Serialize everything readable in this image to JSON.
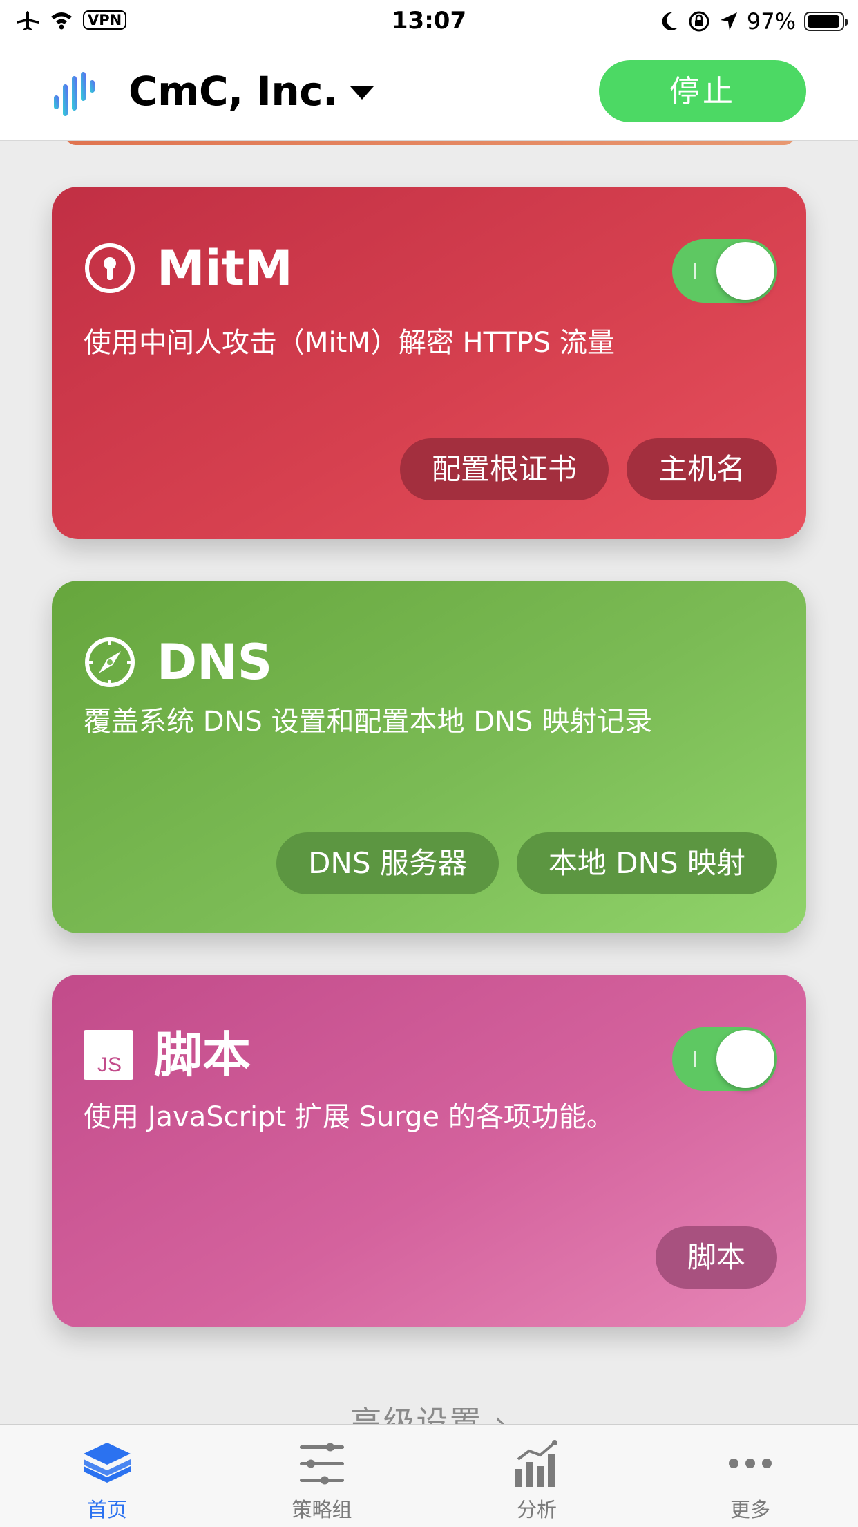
{
  "status_bar": {
    "vpn_label": "VPN",
    "time": "13:07",
    "battery": "97%"
  },
  "nav": {
    "profile_name": "CmC, Inc.",
    "stop_label": "停止"
  },
  "cards": {
    "mitm": {
      "title": "MitM",
      "description": "使用中间人攻击（MitM）解密 HTTPS 流量",
      "toggle_on": true,
      "buttons": [
        "配置根证书",
        "主机名"
      ]
    },
    "dns": {
      "title": "DNS",
      "description": "覆盖系统 DNS 设置和配置本地 DNS 映射记录",
      "buttons": [
        "DNS 服务器",
        "本地 DNS 映射"
      ]
    },
    "script": {
      "title": "脚本",
      "badge": "JS",
      "description": "使用 JavaScript 扩展 Surge 的各项功能。",
      "toggle_on": true,
      "buttons": [
        "脚本"
      ]
    }
  },
  "advanced_label": "高级设置 ›",
  "tabs": [
    {
      "label": "首页",
      "icon": "layers-icon",
      "active": true
    },
    {
      "label": "策略组",
      "icon": "sliders-icon",
      "active": false
    },
    {
      "label": "分析",
      "icon": "chart-icon",
      "active": false
    },
    {
      "label": "更多",
      "icon": "more-icon",
      "active": false
    }
  ],
  "colors": {
    "accent": "#2b72f0",
    "stop_green": "#4cd964",
    "mitm": "#d6404f",
    "dns": "#7bbb55",
    "script": "#d4629d"
  }
}
